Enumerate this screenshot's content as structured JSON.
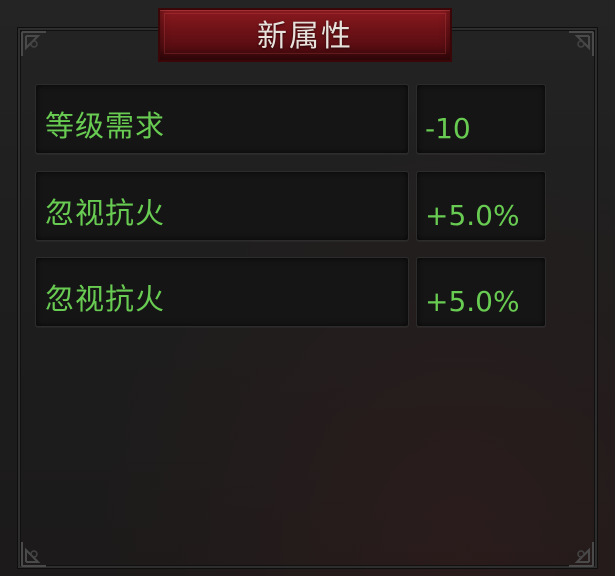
{
  "panel": {
    "title": "新属性"
  },
  "attributes": [
    {
      "name": "等级需求",
      "value": "-10"
    },
    {
      "name": "忽视抗火",
      "value": "+5.0%"
    },
    {
      "name": "忽视抗火",
      "value": "+5.0%"
    }
  ],
  "colors": {
    "text_green": "#69cc52",
    "title_red": "#6e1217",
    "title_text": "#e8e2dc"
  }
}
